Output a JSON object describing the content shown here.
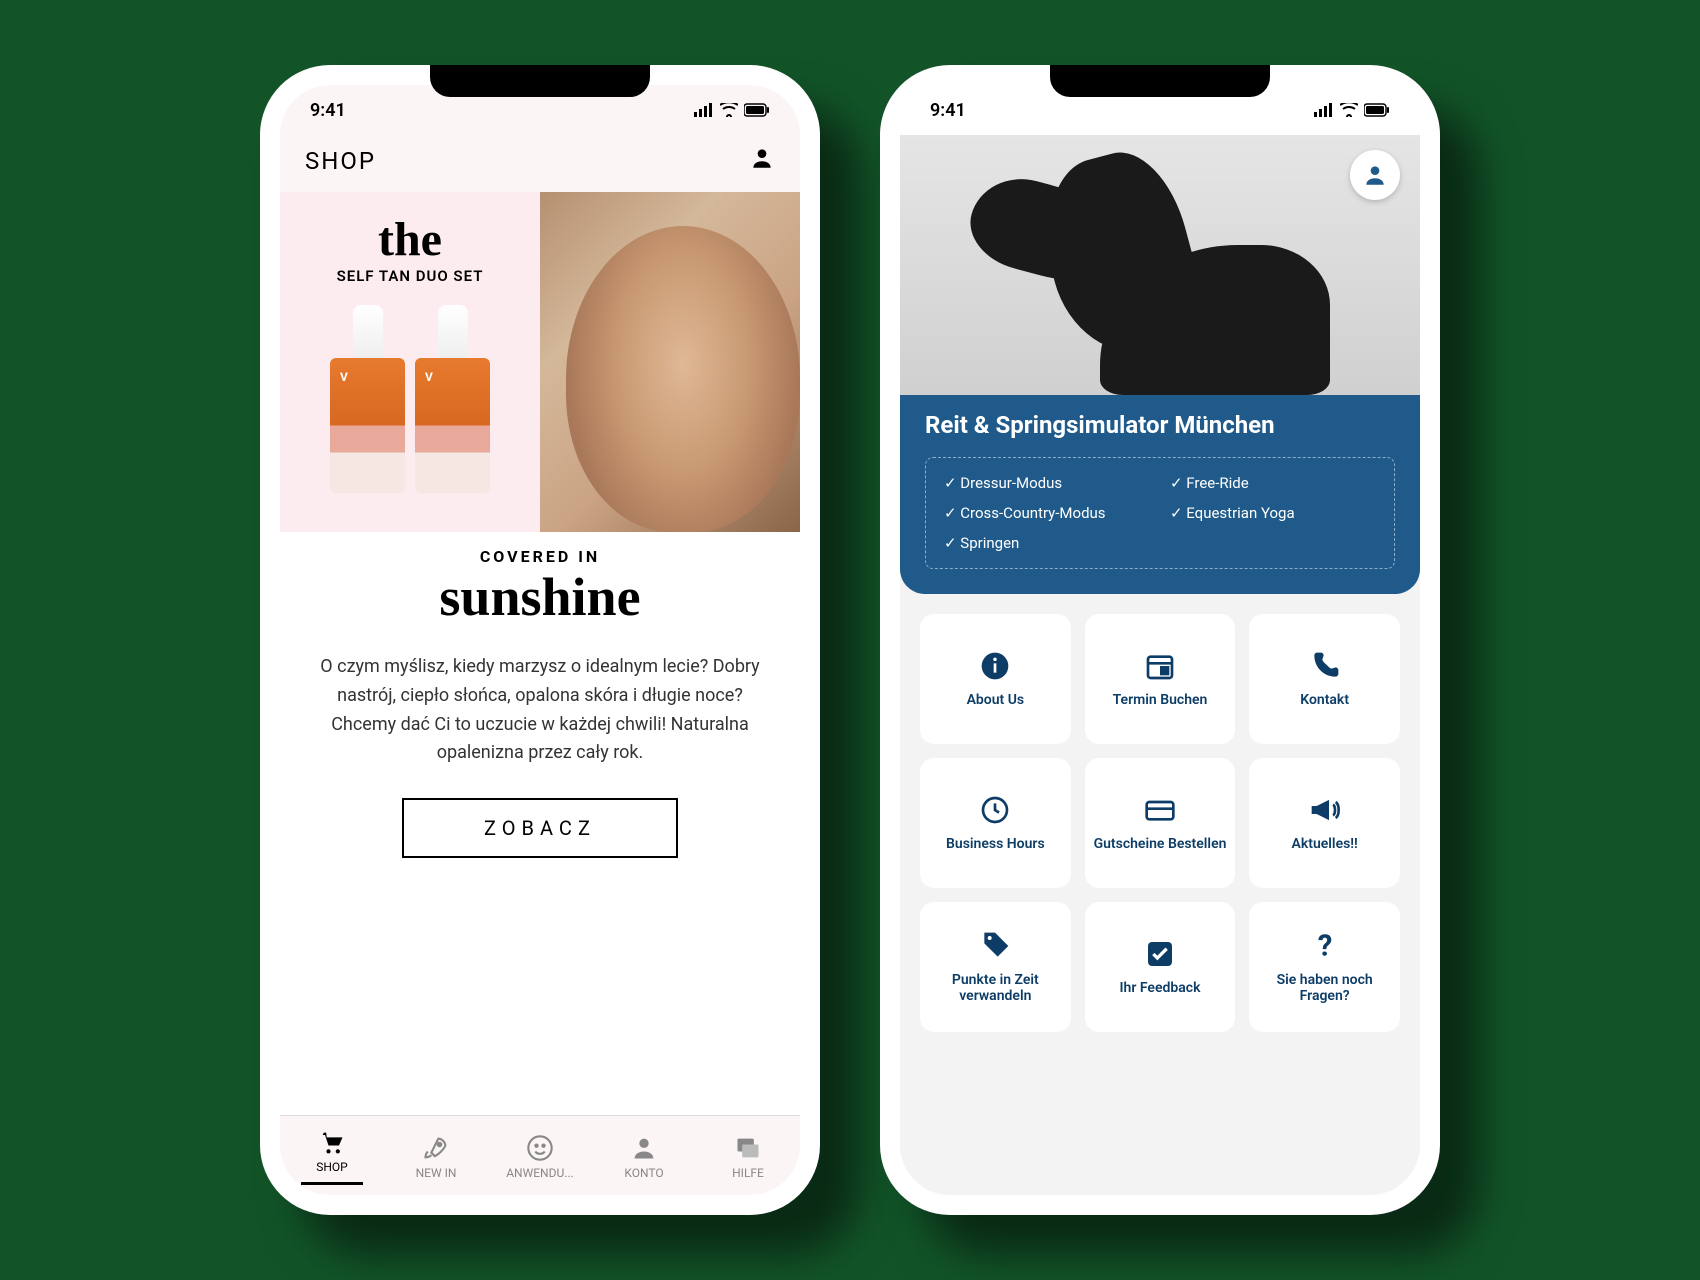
{
  "status": {
    "time": "9:41"
  },
  "phone1": {
    "header_title": "SHOP",
    "hero": {
      "the": "the",
      "subtitle": "SELF TAN DUO SET",
      "covered": "COVERED IN",
      "sunshine": "sunshine"
    },
    "description": "O czym myślisz, kiedy marzysz o idealnym lecie? Dobry nastrój, ciepło słońca, opalona skóra i długie noce? Chcemy dać Ci to uczucie w każdej chwili! Naturalna opalenizna przez cały rok.",
    "cta": "ZOBACZ",
    "tabs": [
      {
        "label": "SHOP",
        "icon": "cart"
      },
      {
        "label": "NEW IN",
        "icon": "rocket"
      },
      {
        "label": "ANWENDU...",
        "icon": "smile"
      },
      {
        "label": "KONTO",
        "icon": "person"
      },
      {
        "label": "HILFE",
        "icon": "chat"
      }
    ]
  },
  "phone2": {
    "title": "Reit & Springsimulator München",
    "features": [
      "Dressur-Modus",
      "Free-Ride",
      "Cross-Country-Modus",
      "Equestrian Yoga",
      "Springen"
    ],
    "tiles": [
      {
        "label": "About Us",
        "icon": "info"
      },
      {
        "label": "Termin Buchen",
        "icon": "calendar"
      },
      {
        "label": "Kontakt",
        "icon": "phone"
      },
      {
        "label": "Business Hours",
        "icon": "clock"
      },
      {
        "label": "Gutscheine Bestellen",
        "icon": "card"
      },
      {
        "label": "Aktuelles!!",
        "icon": "bullhorn"
      },
      {
        "label": "Punkte in Zeit verwandeln",
        "icon": "tag"
      },
      {
        "label": "Ihr Feedback",
        "icon": "check"
      },
      {
        "label": "Sie haben noch Fragen?",
        "icon": "question"
      }
    ]
  }
}
